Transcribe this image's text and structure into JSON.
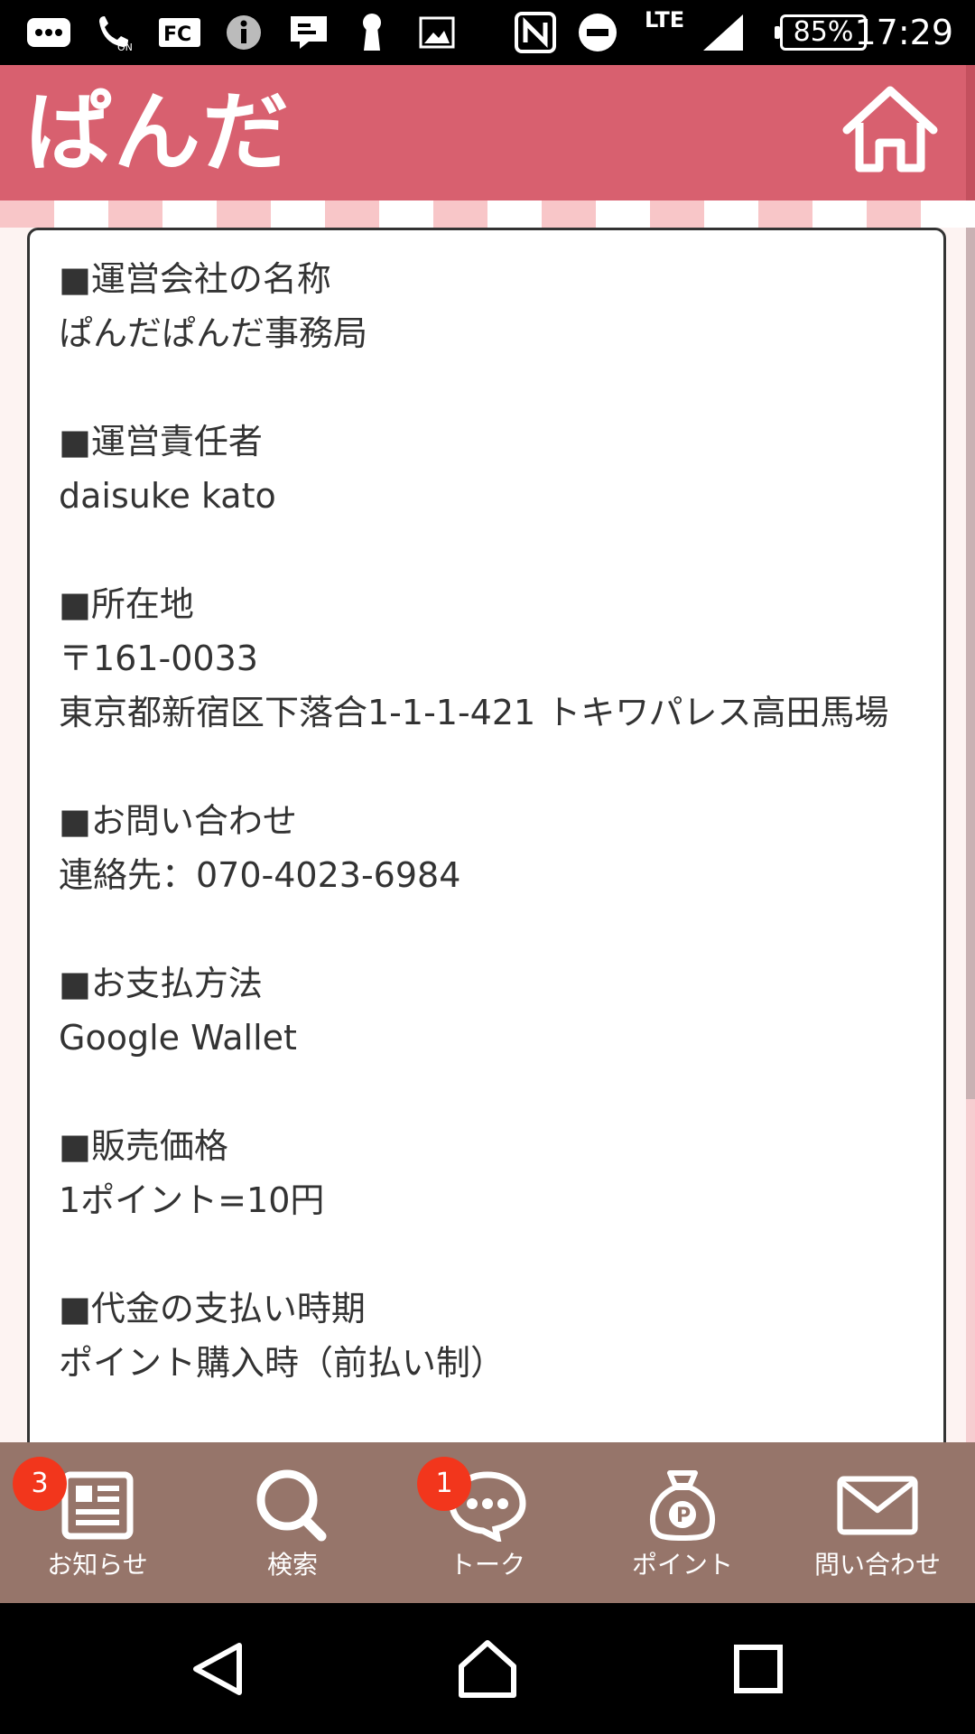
{
  "status_bar": {
    "time": "17:29",
    "battery": "85%",
    "network": "LTE",
    "icons": [
      "more-icon",
      "wifi-calling-icon",
      "fc-icon",
      "info-icon",
      "message-icon",
      "keyhole-icon",
      "image-icon",
      "nfc-icon",
      "do-not-disturb-icon",
      "signal-icon",
      "battery-icon"
    ]
  },
  "header": {
    "logo_text": "ぱんだ",
    "home_icon": "home-icon"
  },
  "content": {
    "sections": [
      {
        "title": "運営会社の名称",
        "lines": [
          "ぱんだぱんだ事務局"
        ]
      },
      {
        "title": "運営責任者",
        "lines": [
          "daisuke kato"
        ]
      },
      {
        "title": "所在地",
        "lines": [
          "〒161-0033",
          "東京都新宿区下落合1-1-1-421 トキワパレス高田馬場"
        ]
      },
      {
        "title": "お問い合わせ",
        "lines": [
          "連絡先：070-4023-6984"
        ]
      },
      {
        "title": "お支払方法",
        "lines": [
          "Google Wallet"
        ]
      },
      {
        "title": "販売価格",
        "lines": [
          "1ポイント=10円"
        ]
      },
      {
        "title": "代金の支払い時期",
        "lines": [
          "ポイント購入時（前払い制）"
        ]
      }
    ]
  },
  "bottom_nav": {
    "items": [
      {
        "label": "お知らせ",
        "badge": "3",
        "icon": "news-icon"
      },
      {
        "label": "検索",
        "badge": "",
        "icon": "search-icon"
      },
      {
        "label": "トーク",
        "badge": "1",
        "icon": "chat-icon"
      },
      {
        "label": "ポイント",
        "badge": "",
        "icon": "point-bag-icon"
      },
      {
        "label": "問い合わせ",
        "badge": "",
        "icon": "mail-icon"
      }
    ]
  },
  "system_nav": {
    "icons": [
      "back-icon",
      "home-nav-icon",
      "recents-icon"
    ]
  },
  "colors": {
    "header": "#d8606f",
    "nav_bg": "#96756a",
    "badge": "#f2361c",
    "checker_pink": "#f8c6c8",
    "text": "#333333"
  }
}
